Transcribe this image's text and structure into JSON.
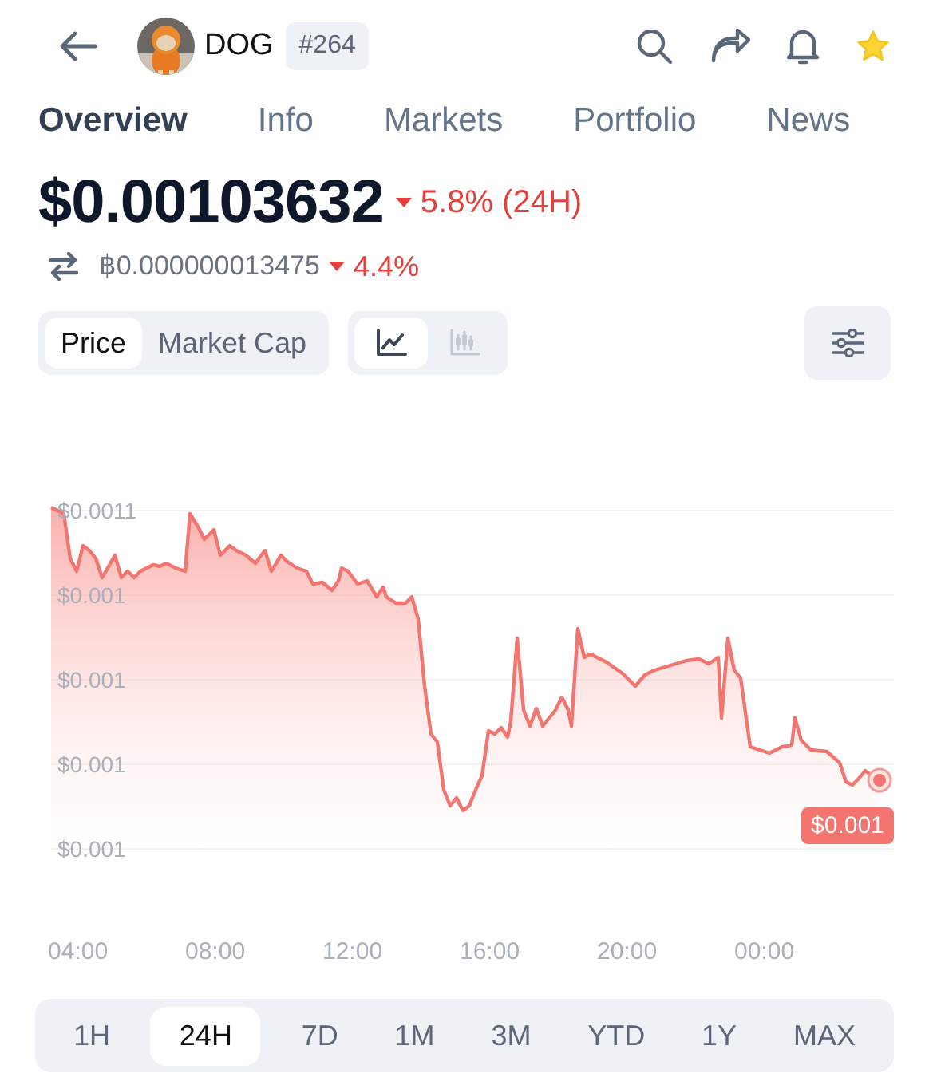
{
  "header": {
    "coin_name": "DOG",
    "rank": "#264",
    "favorite": true
  },
  "tabs": [
    {
      "label": "Overview",
      "selected": true
    },
    {
      "label": "Info",
      "selected": false
    },
    {
      "label": "Markets",
      "selected": false
    },
    {
      "label": "Portfolio",
      "selected": false
    },
    {
      "label": "News",
      "selected": false
    }
  ],
  "price": {
    "value": "$0.00103632",
    "falling": true,
    "change": "5.8% (24H)"
  },
  "btc_price": {
    "value": "฿0.000000013475",
    "falling": true,
    "change": "4.4%"
  },
  "metric_toggle": [
    {
      "label": "Price",
      "selected": true
    },
    {
      "label": "Market Cap",
      "selected": false
    }
  ],
  "chart_type_toggle": [
    {
      "kind": "line",
      "selected": true
    },
    {
      "kind": "candlestick",
      "selected": false
    }
  ],
  "chart": {
    "y_labels": [
      "$0.0011",
      "$0.001",
      "$0.001",
      "$0.001",
      "$0.001"
    ],
    "x_labels": [
      "04:00",
      "08:00",
      "12:00",
      "16:00",
      "20:00",
      "00:00"
    ],
    "current_price_tag": "$0.001"
  },
  "ranges": [
    {
      "label": "1H",
      "selected": false
    },
    {
      "label": "24H",
      "selected": true
    },
    {
      "label": "7D",
      "selected": false
    },
    {
      "label": "1M",
      "selected": false
    },
    {
      "label": "3M",
      "selected": false
    },
    {
      "label": "YTD",
      "selected": false
    },
    {
      "label": "1Y",
      "selected": false
    },
    {
      "label": "MAX",
      "selected": false
    }
  ]
}
